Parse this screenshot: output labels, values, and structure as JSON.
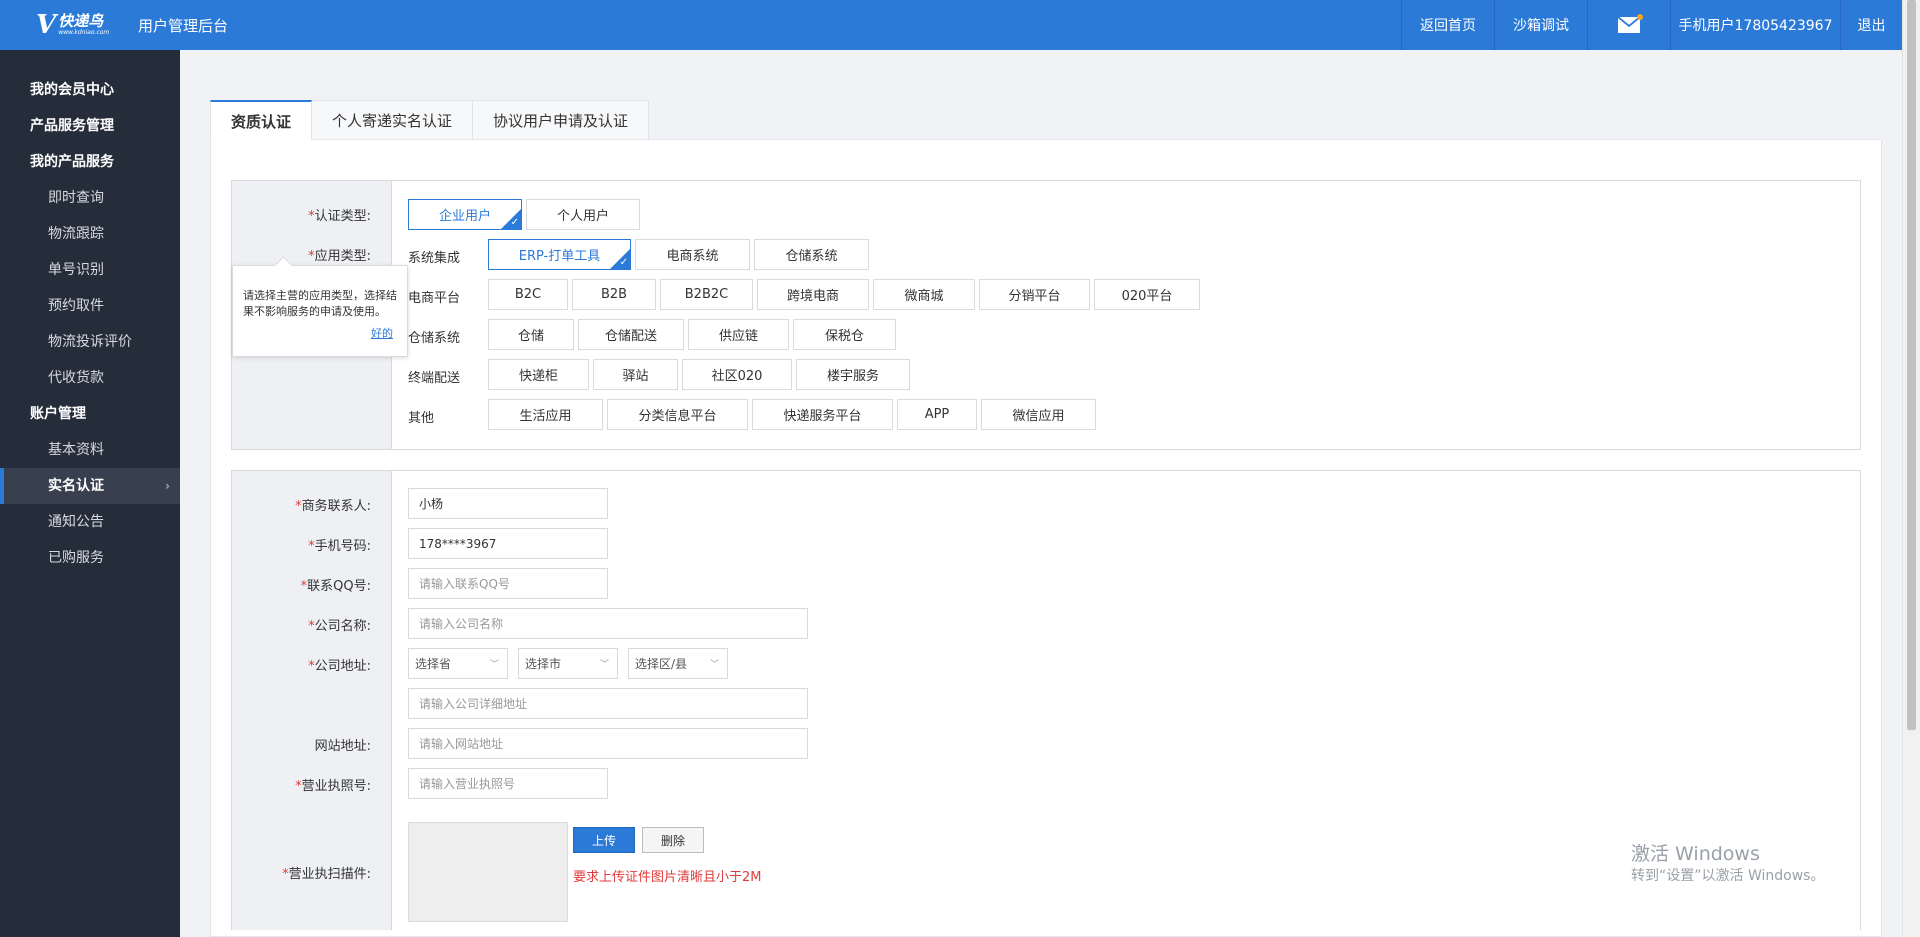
{
  "header": {
    "logo_cn": "快递鸟",
    "logo_url": "www.kdniao.com",
    "app_title": "用户管理后台",
    "nav": {
      "home": "返回首页",
      "sandbox": "沙箱调试",
      "phone_user": "手机用户17805423967",
      "exit": "退出"
    }
  },
  "sidebar": {
    "member_center": "我的会员中心",
    "product_mgmt": "产品服务管理",
    "my_products": "我的产品服务",
    "items_products": [
      "即时查询",
      "物流跟踪",
      "单号识别",
      "预约取件",
      "物流投诉评价",
      "代收货款"
    ],
    "account_mgmt": "账户管理",
    "items_account": [
      "基本资料",
      "实名认证",
      "通知公告",
      "已购服务"
    ],
    "active": "实名认证",
    "active_chevron": "›"
  },
  "tabs": [
    "资质认证",
    "个人寄递实名认证",
    "协议用户申请及认证"
  ],
  "cert": {
    "req_mark": "*",
    "type_label": "认证类型:",
    "type_options": [
      "企业用户",
      "个人用户"
    ],
    "app_label": "应用类型:",
    "groups": [
      {
        "name": "系统集成",
        "options": [
          "ERP-打单工具",
          "电商系统",
          "仓储系统"
        ]
      },
      {
        "name": "电商平台",
        "options": [
          "B2C",
          "B2B",
          "B2B2C",
          "跨境电商",
          "微商城",
          "分销平台",
          "020平台"
        ]
      },
      {
        "name": "仓储系统",
        "options": [
          "仓储",
          "仓储配送",
          "供应链",
          "保税仓"
        ]
      },
      {
        "name": "终端配送",
        "options": [
          "快递柜",
          "驿站",
          "社区020",
          "楼宇服务"
        ]
      },
      {
        "name": "其他",
        "options": [
          "生活应用",
          "分类信息平台",
          "快递服务平台",
          "APP",
          "微信应用"
        ]
      }
    ],
    "check": "✓"
  },
  "tooltip": {
    "text": "请选择主营的应用类型，选择结果不影响服务的申请及使用。",
    "ok": "好的"
  },
  "form": {
    "contact_label": "商务联系人:",
    "contact_value": "小杨",
    "phone_label": "手机号码:",
    "phone_value": "178****3967",
    "qq_label": "联系QQ号:",
    "qq_placeholder": "请输入联系QQ号",
    "company_label": "公司名称:",
    "company_placeholder": "请输入公司名称",
    "address_label": "公司地址:",
    "province": "选择省",
    "city": "选择市",
    "district": "选择区/县",
    "address_placeholder": "请输入公司详细地址",
    "website_label": "网站地址:",
    "website_placeholder": "请输入网站地址",
    "license_label": "营业执照号:",
    "license_placeholder": "请输入营业执照号",
    "scan_label": "营业执扫描件:",
    "upload_btn": "上传",
    "delete_btn": "删除",
    "upload_tip": "要求上传证件图片清晰且小于2M"
  },
  "watermark": {
    "line1": "激活 Windows",
    "line2": "转到“设置”以激活 Windows。"
  },
  "colors": {
    "primary": "#2b7ad8",
    "sidebar_bg": "#262d3a",
    "required": "#e23b3b"
  }
}
